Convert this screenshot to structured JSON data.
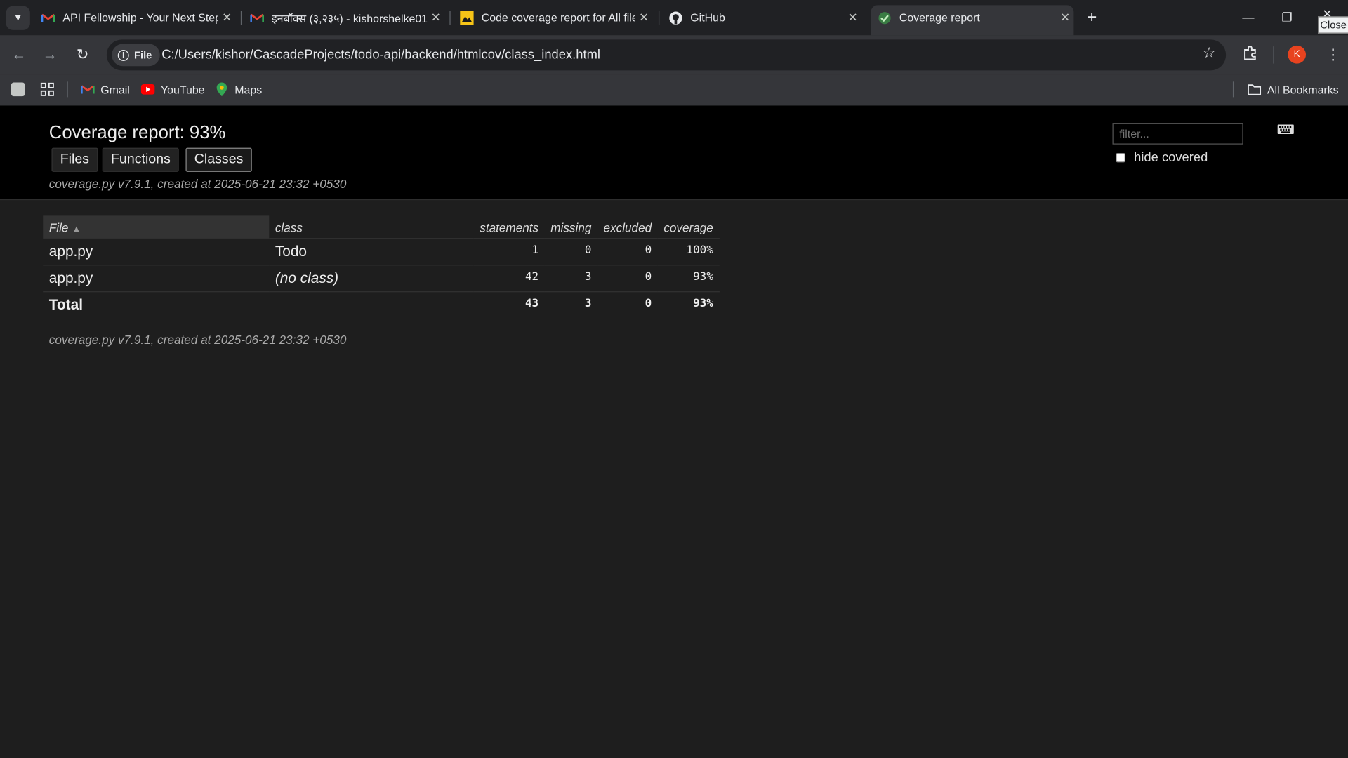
{
  "browser": {
    "tabs": [
      {
        "title": "API Fellowship - Your Next Step",
        "favicon": "gmail-icon"
      },
      {
        "title": "इनबॉक्स (३,२३५) - kishorshelke01",
        "favicon": "gmail-icon"
      },
      {
        "title": "Code coverage report for All files",
        "favicon": "istanbul-icon"
      },
      {
        "title": "GitHub",
        "favicon": "github-icon"
      },
      {
        "title": "Coverage report",
        "favicon": "coverage-icon",
        "active": true
      }
    ],
    "tooltip": "Close",
    "address": {
      "scheme_chip": "File",
      "url": "C:/Users/kishor/CascadeProjects/todo-api/backend/htmlcov/class_index.html"
    },
    "profile_initial": "K",
    "bookmarks": [
      {
        "label": "Gmail",
        "icon": "gmail-icon"
      },
      {
        "label": "YouTube",
        "icon": "youtube-icon"
      },
      {
        "label": "Maps",
        "icon": "maps-icon"
      }
    ],
    "all_bookmarks": "All Bookmarks"
  },
  "report": {
    "title": "Coverage report: 93%",
    "nav": {
      "files": "Files",
      "functions": "Functions",
      "classes": "Classes"
    },
    "created": "coverage.py v7.9.1, created at 2025-06-21 23:32 +0530",
    "filter_placeholder": "filter...",
    "hide_covered": "hide covered",
    "columns": {
      "file": "File",
      "class": "class",
      "statements": "statements",
      "missing": "missing",
      "excluded": "excluded",
      "coverage": "coverage"
    },
    "rows": [
      {
        "file": "app.py",
        "class": "Todo",
        "statements": "1",
        "missing": "0",
        "excluded": "0",
        "coverage": "100%"
      },
      {
        "file": "app.py",
        "class": "(no class)",
        "statements": "42",
        "missing": "3",
        "excluded": "0",
        "coverage": "93%"
      }
    ],
    "total": {
      "label": "Total",
      "statements": "43",
      "missing": "3",
      "excluded": "0",
      "coverage": "93%"
    }
  },
  "colors": {
    "page_background": "#1e1e1e",
    "header_background": "#000000",
    "accent_avatar": "#e8431f"
  }
}
